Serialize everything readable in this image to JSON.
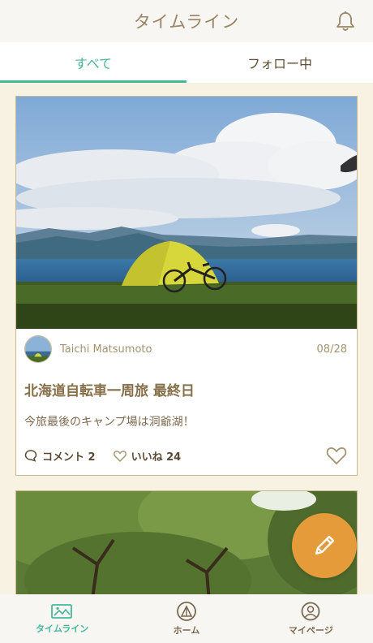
{
  "header": {
    "title": "タイムライン"
  },
  "tabs": [
    {
      "label": "すべて",
      "active": true
    },
    {
      "label": "フォロー中",
      "active": false
    }
  ],
  "posts": [
    {
      "author": "Taichi Matsumoto",
      "date": "08/28",
      "title": "北海道自転車一周旅 最終日",
      "body": "今旅最後のキャンプ場は洞爺湖！",
      "comment_label": "コメント 2",
      "like_label": "いいね 24"
    }
  ],
  "bottom_nav": [
    {
      "label": "タイムライン",
      "active": true,
      "icon": "timeline-icon"
    },
    {
      "label": "ホーム",
      "active": false,
      "icon": "home-icon"
    },
    {
      "label": "マイページ",
      "active": false,
      "icon": "profile-icon"
    }
  ],
  "colors": {
    "accent": "#45b89a",
    "fab": "#e69b3a",
    "background": "#f7f2e2",
    "text_brown": "#86704a"
  }
}
